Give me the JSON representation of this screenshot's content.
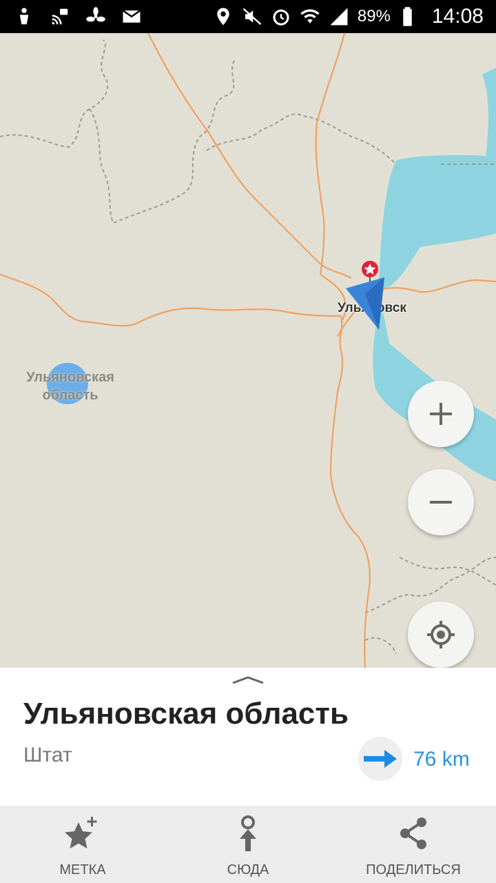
{
  "status_bar": {
    "battery_percent": "89%",
    "time": "14:08",
    "icons": [
      "usb-debug-icon",
      "cast-icon",
      "fan-icon",
      "mail-icon",
      "location-icon",
      "mute-icon",
      "alarm-icon",
      "wifi-icon",
      "signal-icon",
      "battery-icon"
    ]
  },
  "map": {
    "city_label": "Ульяновск",
    "region_label_line1": "Ульяновская",
    "region_label_line2": "область",
    "water_color": "#8dd4e0",
    "road_color": "#f0a060",
    "land_color": "#e2e0d4",
    "zoom_in_icon": "plus-icon",
    "zoom_out_icon": "minus-icon",
    "locate_icon": "crosshair-icon"
  },
  "place_sheet": {
    "title": "Ульяновская область",
    "type": "Штат",
    "distance": "76 km",
    "direction_icon": "arrow-right-icon"
  },
  "bottom_nav": {
    "items": [
      {
        "label": "МЕТКА",
        "icon": "add-bookmark-star-icon"
      },
      {
        "label": "СЮДА",
        "icon": "route-here-icon"
      },
      {
        "label": "ПОДЕЛИТЬСЯ",
        "icon": "share-icon"
      }
    ]
  }
}
